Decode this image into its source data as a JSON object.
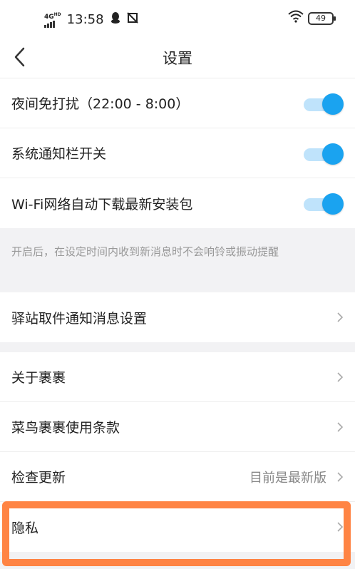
{
  "status_bar": {
    "network": "4G",
    "network_sup": "HD",
    "time": "13:58",
    "battery": "49",
    "icons": [
      "signal-icon",
      "qq-icon",
      "notification-blocked-icon",
      "wifi-icon",
      "battery-icon"
    ]
  },
  "header": {
    "title": "设置",
    "back_icon": "back-arrow-icon"
  },
  "toggles": [
    {
      "label": "夜间免打扰（22:00 - 8:00）",
      "on": true
    },
    {
      "label": "系统通知栏开关",
      "on": true
    },
    {
      "label": "Wi-Fi网络自动下载最新安装包",
      "on": true
    }
  ],
  "hint": "开启后，在设定时间内收到新消息时不会响铃或振动提醒",
  "station_row": {
    "label": "驿站取件通知消息设置"
  },
  "about_rows": [
    {
      "label": "关于裹裹",
      "value": ""
    },
    {
      "label": "菜鸟裹裹使用条款",
      "value": ""
    },
    {
      "label": "检查更新",
      "value": "目前是最新版"
    },
    {
      "label": "隐私",
      "value": ""
    }
  ],
  "colors": {
    "toggle_accent": "#1aa3f0",
    "highlight_border": "#ff8444"
  }
}
